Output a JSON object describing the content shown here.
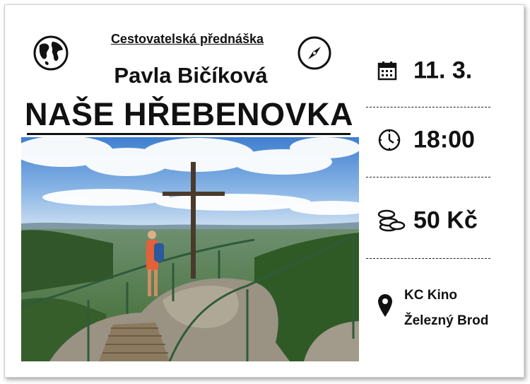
{
  "poster": {
    "subtitle": "Cestovatelská přednáška",
    "speaker": "Pavla Bičíková",
    "title": "NAŠE HŘEBENOVKA"
  },
  "details": {
    "date": "11. 3.",
    "time": "18:00",
    "price": "50 Kč",
    "venue_line1": "KC Kino",
    "venue_line2": "Železný Brod"
  },
  "icons": {
    "globe": "globe-icon",
    "compass": "compass-icon",
    "calendar": "calendar-icon",
    "clock": "clock-icon",
    "coins": "coins-icon",
    "pin": "location-pin-icon"
  },
  "colors": {
    "text": "#111111",
    "sky": "#4f8fd6",
    "forest": "#2f5a26",
    "rock": "#9a9282"
  }
}
